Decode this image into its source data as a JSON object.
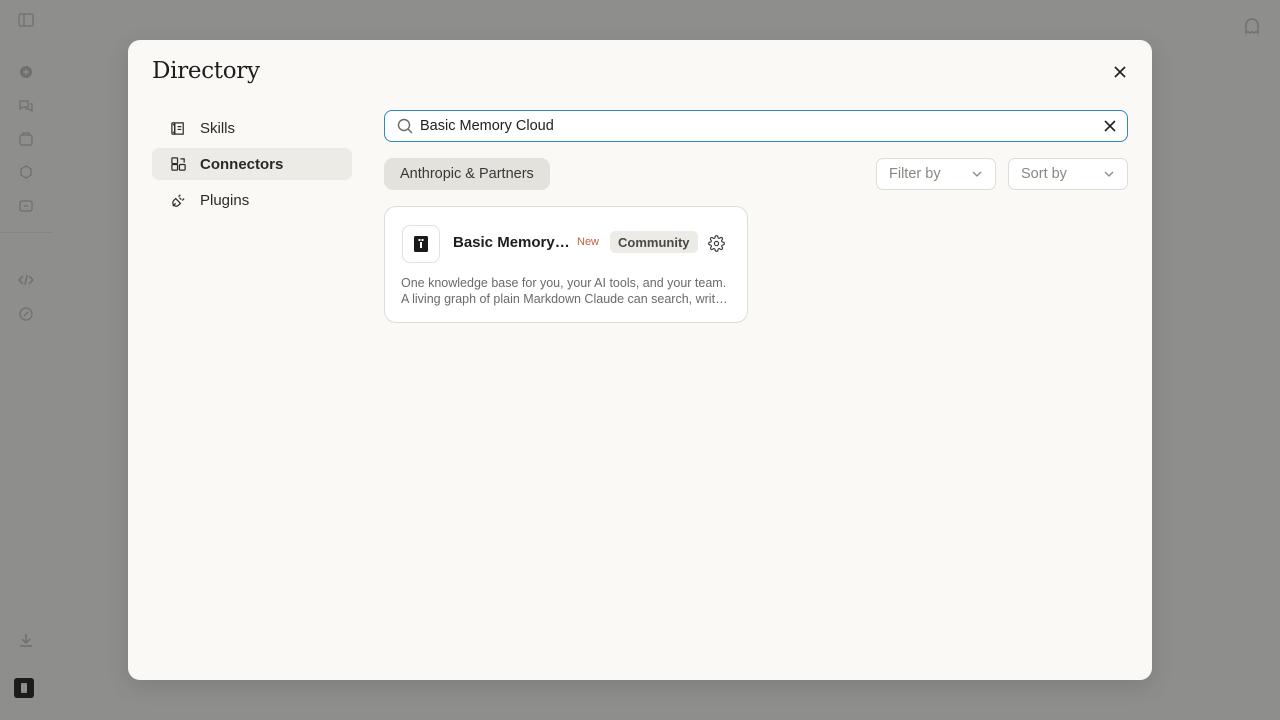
{
  "directory": {
    "title": "Directory",
    "nav": [
      {
        "label": "Skills",
        "icon": "skills-icon",
        "active": false
      },
      {
        "label": "Connectors",
        "icon": "connectors-icon",
        "active": true
      },
      {
        "label": "Plugins",
        "icon": "plugins-icon",
        "active": false
      }
    ],
    "search": {
      "value": "Basic Memory Cloud",
      "placeholder": "Search"
    },
    "filters": {
      "chip_label": "Anthropic & Partners",
      "filter_label": "Filter by",
      "sort_label": "Sort by"
    },
    "results": [
      {
        "name": "Basic Memory Cloud",
        "new_label": "New",
        "badge": "Community",
        "description_line1": "One knowledge base for you, your AI tools, and your team.",
        "description_line2": "A living graph of plain Markdown Claude can search, write, and edit"
      }
    ]
  },
  "colors": {
    "accent_focus": "#2f86c9",
    "new_label": "#c2613a",
    "overlay_bg": "#8e8e8c",
    "modal_bg": "#faf9f5"
  }
}
